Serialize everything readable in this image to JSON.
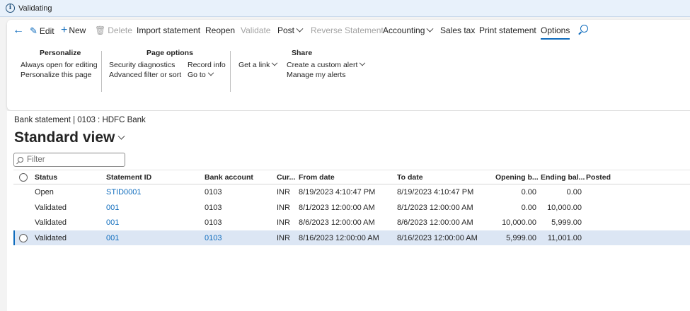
{
  "window": {
    "title": "Validating"
  },
  "toolbar": {
    "edit": "Edit",
    "new": "New",
    "delete": "Delete",
    "import_statement": "Import statement",
    "reopen": "Reopen",
    "validate": "Validate",
    "post": "Post",
    "reverse_statement": "Reverse Statement",
    "accounting": "Accounting",
    "sales_tax": "Sales tax",
    "print_statement": "Print statement",
    "options": "Options"
  },
  "options_pane": {
    "personalize": {
      "title": "Personalize",
      "items": [
        "Always open for editing",
        "Personalize this page"
      ]
    },
    "page_options": {
      "title": "Page options",
      "items": [
        "Security diagnostics",
        "Advanced filter or sort",
        "Record info",
        "Go to"
      ]
    },
    "share": {
      "title": "Share",
      "items": [
        "Get a link",
        "Create a custom alert",
        "Manage my alerts"
      ]
    }
  },
  "page": {
    "breadcrumb": "Bank statement  |  0103 : HDFC Bank",
    "view_title": "Standard view",
    "filter_placeholder": "Filter"
  },
  "grid": {
    "columns": [
      "Status",
      "Statement ID",
      "Bank account",
      "Cur...",
      "From date",
      "To date",
      "Opening b...",
      "Ending bal...",
      "Posted"
    ],
    "rows": [
      {
        "status": "Open",
        "statement_id": "STID0001",
        "bank_account": "0103",
        "currency": "INR",
        "from_date": "8/19/2023 4:10:47 PM",
        "to_date": "8/19/2023 4:10:47 PM",
        "opening": "0.00",
        "ending": "0.00",
        "posted": ""
      },
      {
        "status": "Validated",
        "statement_id": "001",
        "bank_account": "0103",
        "currency": "INR",
        "from_date": "8/1/2023 12:00:00 AM",
        "to_date": "8/1/2023 12:00:00 AM",
        "opening": "0.00",
        "ending": "10,000.00",
        "posted": ""
      },
      {
        "status": "Validated",
        "statement_id": "001",
        "bank_account": "0103",
        "currency": "INR",
        "from_date": "8/6/2023 12:00:00 AM",
        "to_date": "8/6/2023 12:00:00 AM",
        "opening": "10,000.00",
        "ending": "5,999.00",
        "posted": ""
      },
      {
        "status": "Validated",
        "statement_id": "001",
        "bank_account": "0103",
        "currency": "INR",
        "from_date": "8/16/2023 12:00:00 AM",
        "to_date": "8/16/2023 12:00:00 AM",
        "opening": "5,999.00",
        "ending": "11,001.00",
        "posted": ""
      }
    ],
    "selected_row": 3
  },
  "colors": {
    "accent": "#0f6cbd",
    "selected_row": "#dce6f4",
    "titlebar": "#e8f1fb"
  }
}
